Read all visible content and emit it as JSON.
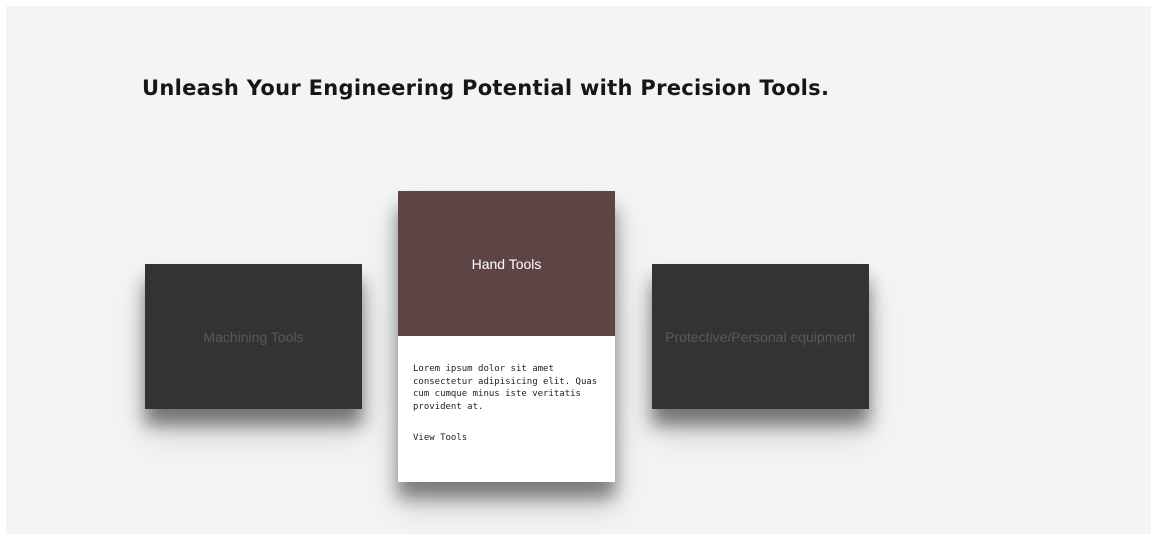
{
  "hero": {
    "headline": "Unleash Your Engineering Potential with Precision Tools."
  },
  "cards": [
    {
      "title": "Machining Tools",
      "state": "inactive"
    },
    {
      "title": "Hand Tools",
      "state": "active",
      "description": "Lorem ipsum dolor sit amet consectetur adipisicing elit. Quas cum cumque minus iste veritatis provident at.",
      "link_label": "View Tools"
    },
    {
      "title": "Protective/Personal equipment",
      "state": "inactive"
    }
  ],
  "colors": {
    "page_background": "#f3f5f5",
    "card_dark": "#333333",
    "card_active_header": "#5f4446",
    "card_body": "#ffffff",
    "headline": "#161616"
  }
}
